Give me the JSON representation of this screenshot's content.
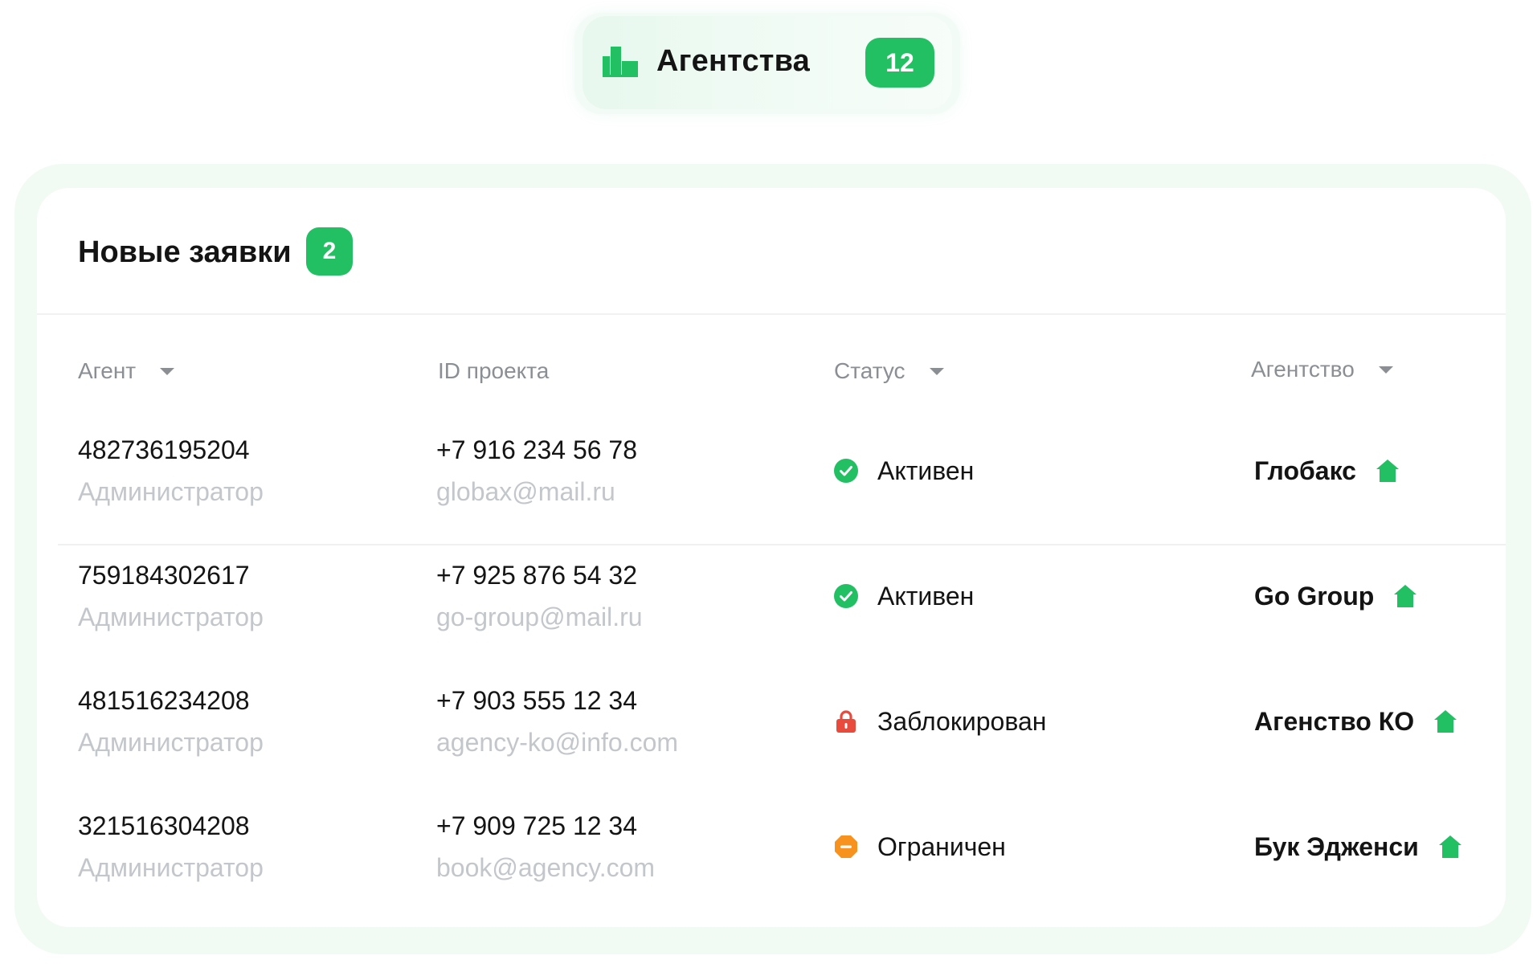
{
  "header": {
    "title": "Агентства",
    "count": "12",
    "icon": "buildings-icon",
    "accent": "#22bf63"
  },
  "card": {
    "title": "Новые заявки",
    "count": "2"
  },
  "table": {
    "columns": [
      {
        "label": "Агент",
        "sortable": true
      },
      {
        "label": "ID проекта",
        "sortable": false
      },
      {
        "label": "Статус",
        "sortable": true
      },
      {
        "label": "Агентство",
        "sortable": true
      }
    ],
    "rows": [
      {
        "agent_id": "482736195204",
        "role": "Администратор",
        "phone": "+7 916 234 56 78",
        "email": "globax@mail.ru",
        "status": "Активен",
        "status_icon": "check-circle-icon",
        "status_color": "#22bf63",
        "agency": "Глобакс"
      },
      {
        "agent_id": "759184302617",
        "role": "Администратор",
        "phone": "+7 925 876 54 32",
        "email": "go-group@mail.ru",
        "status": "Активен",
        "status_icon": "check-circle-icon",
        "status_color": "#22bf63",
        "agency": "Go Group"
      },
      {
        "agent_id": "481516234208",
        "role": "Администратор",
        "phone": "+7 903 555 12 34",
        "email": "agency-ko@info.com",
        "status": "Заблокирован",
        "status_icon": "lock-icon",
        "status_color": "#e84a3c",
        "agency": "Агенство КО"
      },
      {
        "agent_id": "321516304208",
        "role": "Администратор",
        "phone": "+7 909 725 12 34",
        "email": "book@agency.com",
        "status": "Ограничен",
        "status_icon": "minus-octagon-icon",
        "status_color": "#f7921e",
        "agency": "Бук Эдженси"
      }
    ]
  }
}
